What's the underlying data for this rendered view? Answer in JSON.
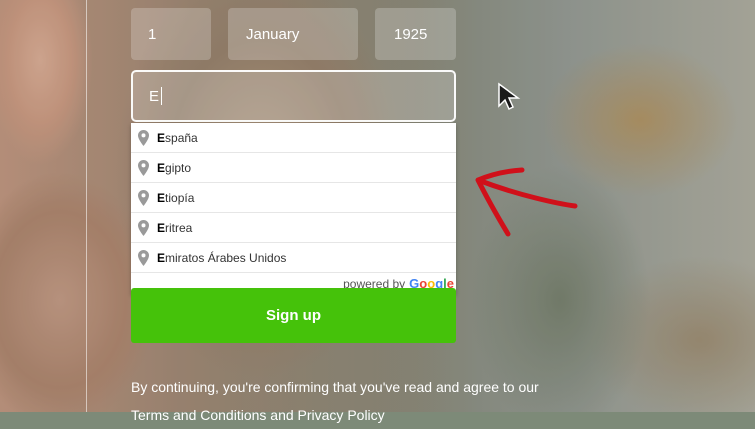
{
  "birthdate": {
    "day": "1",
    "month": "January",
    "year": "1925"
  },
  "country_input": {
    "value": "E"
  },
  "suggestions": [
    {
      "bold": "E",
      "rest": "spaña"
    },
    {
      "bold": "E",
      "rest": "gipto"
    },
    {
      "bold": "E",
      "rest": "tiopía"
    },
    {
      "bold": "E",
      "rest": "ritrea"
    },
    {
      "bold": "E",
      "rest": "miratos Árabes Unidos"
    }
  ],
  "powered_by": {
    "prefix": "powered by",
    "brand": "Google"
  },
  "signup_button": "Sign up",
  "legal": {
    "line1": "By continuing, you're confirming that you've read and agree to our",
    "line2": "Terms and Conditions and Privacy Policy"
  },
  "colors": {
    "signup": "#45c20a",
    "annotation_arrow": "#d0101a"
  },
  "google_colors": [
    "#4285F4",
    "#EA4335",
    "#FBBC05",
    "#4285F4",
    "#34A853",
    "#EA4335"
  ]
}
